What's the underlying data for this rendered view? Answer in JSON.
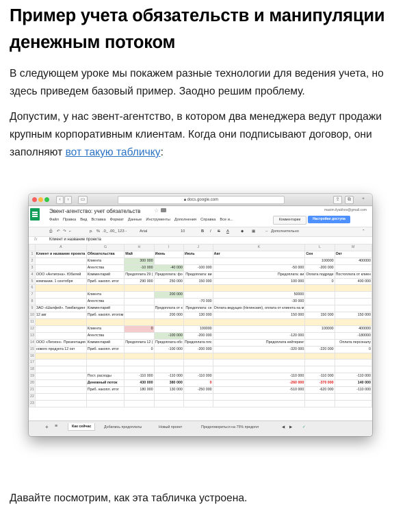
{
  "article": {
    "title": "Пример учета обязательств и манипуляции денежным потоком",
    "p1": "В следующем уроке мы покажем разные технологии для ведения учета, но здесь приведем базовый пример. Заодно решим проблему.",
    "p2_before": "Допустим, у нас эвент-агентство, в котором два менеджера ведут продажи крупным корпоративным клиентам. Когда они подписывают договор, они заполняют ",
    "p2_link": "вот такую табличку",
    "p2_after": ":",
    "p4": "Давайте посмотрим, как эта табличка устроена."
  },
  "browser": {
    "url": "docs.google.com"
  },
  "sheet": {
    "doc_title": "Эвент-агентство: учет обязательств",
    "menu": [
      "Файл",
      "Правка",
      "Вид",
      "Вставка",
      "Формат",
      "Данные",
      "Инструменты",
      "Дополнения",
      "Справка",
      "Все и..."
    ],
    "account_email": "maxim.ilyakhov@gmail.com",
    "comments_label": "Комментарии",
    "share_label": "Настройки доступа",
    "toolbar": {
      "zoom": "р.",
      "percent": "%",
      "dec": ".0_ .00_ 123 -",
      "font": "Arial",
      "size": "10",
      "bold": "B",
      "italic": "I",
      "strike": "S",
      "color": "A",
      "more": "Дополнительно"
    },
    "formula_bar": {
      "fx": "fx",
      "content": "Клиент и название проекта"
    },
    "columns": [
      "",
      "A",
      "G",
      "H",
      "I",
      "J",
      "K",
      "L",
      "M"
    ],
    "rows": [
      {
        "n": "1",
        "a": "Клиент и название проекта",
        "g": "Обязательства",
        "h": "Май",
        "i": "Июнь",
        "j": "Июль",
        "k": "Авг",
        "l": "Сен",
        "m": "Окт"
      },
      {
        "n": "2",
        "a": "",
        "g": "Клиента",
        "h": "300 000",
        "i": "",
        "j": "",
        "k": "",
        "l": "100000",
        "m": "400000"
      },
      {
        "n": "3",
        "a": "",
        "g": "Агентства",
        "h": "-10 000",
        "i": "-40 000",
        "j": "-100 000",
        "k": "-50 000",
        "l": "-200 000",
        "m": ""
      },
      {
        "n": "4",
        "a": "ООО «Антигона». Юбилей",
        "g": "Комментарий",
        "h": "Предоплата 29 (",
        "i": "Предоплата: фо",
        "j": "Предоплата: ви",
        "k": "Предоплата: ви",
        "l": "Оплата подряде",
        "m": "Постоплата от клиен"
      },
      {
        "n": "5",
        "a": "компании. 1 сентября",
        "g": "Приб. накопл. итог",
        "h": "290 000",
        "i": "250 000",
        "j": "150 000",
        "k": "100 000",
        "l": "0",
        "m": "400 000"
      },
      {
        "n": "6",
        "a": "",
        "g": "",
        "h": "",
        "i": "",
        "j": "",
        "k": "",
        "l": "",
        "m": ""
      },
      {
        "n": "7",
        "a": "",
        "g": "Клиента",
        "h": "",
        "i": "200 000",
        "j": "",
        "k": "50000",
        "l": "",
        "m": ""
      },
      {
        "n": "8",
        "a": "",
        "g": "Агентства",
        "h": "",
        "i": "",
        "j": "-70 000",
        "k": "-30 000",
        "l": "",
        "m": ""
      },
      {
        "n": "9",
        "a": "ЗАО «Шалфей». Тимбилдинг",
        "g": "Комментарий",
        "h": "",
        "i": "Предоплата от к",
        "j": "Предоплата: се",
        "k": "Оплата ведущих (Негинские), оплата от клиента на м",
        "l": "",
        "m": ""
      },
      {
        "n": "10",
        "a": "12 авг",
        "g": "Приб. накопл. итогом",
        "h": "",
        "i": "200 000",
        "j": "130 000",
        "k": "150 000",
        "l": "150 000",
        "m": "150 000"
      },
      {
        "n": "11",
        "a": "",
        "g": "",
        "h": "",
        "i": "",
        "j": "",
        "k": "",
        "l": "",
        "m": ""
      },
      {
        "n": "12",
        "a": "",
        "g": "Клиента",
        "h": "0",
        "i": "",
        "j": "100000",
        "k": "",
        "l": "100000",
        "m": "400000"
      },
      {
        "n": "13",
        "a": "",
        "g": "Агентства",
        "h": "",
        "i": "-100 000",
        "j": "-200 000",
        "k": "-120 000",
        "l": "",
        "m": "-180000"
      },
      {
        "n": "14",
        "a": "ООО «Легион». Презентация",
        "g": "Комментарий",
        "h": "Предоплата 12 (",
        "i": "Предоплата обс",
        "j": "Предоплата плс",
        "k": "Предоплата кейтеринг",
        "l": "",
        "m": "Оплата персоналу"
      },
      {
        "n": "15",
        "a": "нового продукта 12 окт",
        "g": "Приб. накопл. итог",
        "h": "0",
        "i": "-100 000",
        "j": "-200 000",
        "k": "-320 000",
        "l": "-220 000",
        "m": "0"
      },
      {
        "n": "16",
        "a": "",
        "g": "",
        "h": "",
        "i": "",
        "j": "",
        "k": "",
        "l": "",
        "m": ""
      },
      {
        "n": "17",
        "a": "",
        "g": "",
        "h": "",
        "i": "",
        "j": "",
        "k": "",
        "l": "",
        "m": ""
      },
      {
        "n": "18",
        "a": "",
        "g": "",
        "h": "",
        "i": "",
        "j": "",
        "k": "",
        "l": "",
        "m": ""
      },
      {
        "n": "19",
        "a": "",
        "g": "Пост. расходы",
        "h": "-110 000",
        "i": "-110 000",
        "j": "-110 000",
        "k": "-110 000",
        "l": "-110 000",
        "m": "-110 000"
      },
      {
        "n": "20",
        "a": "",
        "g": "Денежный поток",
        "h": "430 000",
        "i": "380 000",
        "j": "0",
        "k": "-260 000",
        "l": "-370 000",
        "m": "140 000"
      },
      {
        "n": "21",
        "a": "",
        "g": "Приб. накопл. итог",
        "h": "180 000",
        "i": "130 000",
        "j": "-250 000",
        "k": "-510 000",
        "l": "-620 000",
        "m": "-110 000"
      },
      {
        "n": "22",
        "a": "",
        "g": "",
        "h": "",
        "i": "",
        "j": "",
        "k": "",
        "l": "",
        "m": ""
      },
      {
        "n": "23",
        "a": "",
        "g": "",
        "h": "",
        "i": "",
        "j": "",
        "k": "",
        "l": "",
        "m": ""
      }
    ],
    "tabs": [
      "Как сейчас",
      "Добились предоплаты",
      "Новый проект",
      "Предоговориться на 75% предопл"
    ]
  }
}
